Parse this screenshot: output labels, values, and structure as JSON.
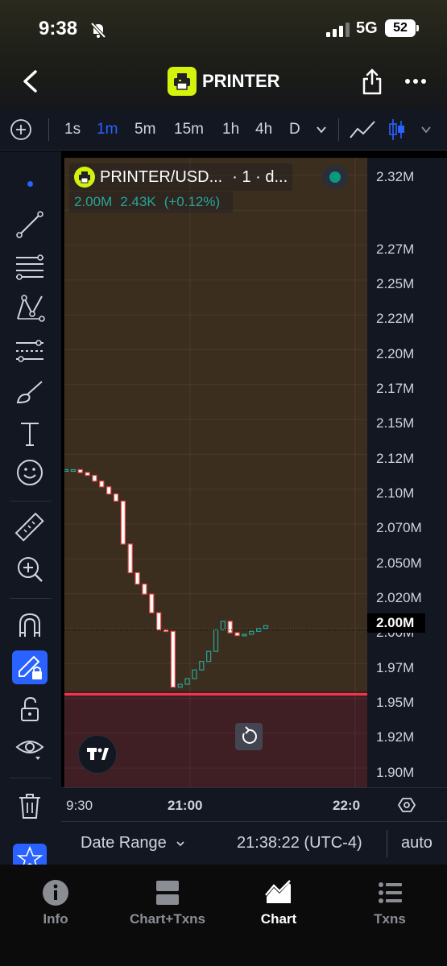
{
  "status_bar": {
    "time": "9:38",
    "network": "5G",
    "battery": "52"
  },
  "header": {
    "title": "PRINTER"
  },
  "intervals": [
    "1s",
    "1m",
    "5m",
    "15m",
    "1h",
    "4h",
    "D"
  ],
  "active_interval": "1m",
  "legend": {
    "symbol": "PRINTER/USD...",
    "meta": "· 1 · d...",
    "volume": "2.00M",
    "change_abs": "2.43K",
    "change_pct": "(+0.12%)"
  },
  "price_scale": {
    "labels": [
      "2.32M",
      "2.27M",
      "2.25M",
      "2.22M",
      "2.20M",
      "2.17M",
      "2.15M",
      "2.12M",
      "2.10M",
      "2.070M",
      "2.050M",
      "2.020M",
      "2.00M",
      "1.97M",
      "1.95M",
      "1.92M",
      "1.90M"
    ],
    "current": "2.00M"
  },
  "time_scale": {
    "labels": [
      "9:30",
      "21:00",
      "22:0"
    ]
  },
  "info_bar": {
    "date_range": "Date Range",
    "clock": "21:38:22 (UTC-4)",
    "scale_mode": "auto"
  },
  "tabs": [
    {
      "label": "Info",
      "icon": "info-icon"
    },
    {
      "label": "Chart+Txns",
      "icon": "chart-txns-icon"
    },
    {
      "label": "Chart",
      "icon": "chart-icon"
    },
    {
      "label": "Txns",
      "icon": "list-icon"
    }
  ],
  "active_tab": "Chart",
  "colors": {
    "accent": "#2962ff",
    "up": "#26a69a",
    "down": "#ef5350",
    "brand": "#d4f30c",
    "position_line": "#f23645"
  },
  "chart_data": {
    "type": "candlestick",
    "series": [
      {
        "name": "PRINTER/USD",
        "values": [
          2.112,
          2.112,
          2.11,
          2.108,
          2.104,
          2.1,
          2.095,
          2.09,
          2.06,
          2.04,
          2.032,
          2.025,
          2.012,
          2.0,
          1.999,
          1.96,
          1.962,
          1.966,
          1.972,
          1.978,
          1.985,
          2.0,
          2.006,
          1.998,
          1.996,
          1.997,
          1.999,
          2.001,
          2.003
        ]
      }
    ],
    "ylim": [
      1.89,
      2.33
    ],
    "x_ticks": [
      "9:30",
      "21:00",
      "22:0"
    ],
    "price_line": 1.955,
    "last_price": 2.0
  }
}
